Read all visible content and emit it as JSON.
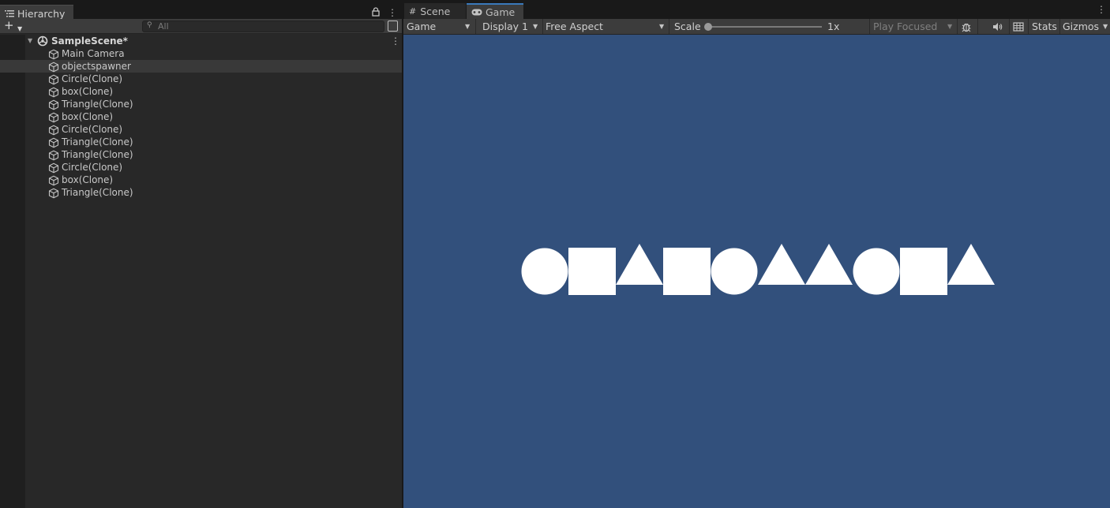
{
  "hierarchy": {
    "tab_label": "Hierarchy",
    "search_placeholder": "All",
    "scene_name": "SampleScene*",
    "items": [
      {
        "label": "Main Camera"
      },
      {
        "label": "objectspawner",
        "selected": true
      },
      {
        "label": "Circle(Clone)"
      },
      {
        "label": "box(Clone)"
      },
      {
        "label": "Triangle(Clone)"
      },
      {
        "label": "box(Clone)"
      },
      {
        "label": "Circle(Clone)"
      },
      {
        "label": "Triangle(Clone)"
      },
      {
        "label": "Triangle(Clone)"
      },
      {
        "label": "Circle(Clone)"
      },
      {
        "label": "box(Clone)"
      },
      {
        "label": "Triangle(Clone)"
      }
    ]
  },
  "game_panel": {
    "tabs": {
      "scene": "Scene",
      "game": "Game"
    },
    "toolbar": {
      "view_mode": "Game",
      "display": "Display 1",
      "aspect": "Free Aspect",
      "scale_label": "Scale",
      "scale_value": "1x",
      "play_mode": "Play Focused",
      "stats": "Stats",
      "gizmos": "Gizmos"
    },
    "background_color": "#32507c",
    "shape_color": "#ffffff",
    "shapes": [
      "circle",
      "box",
      "triangle",
      "box",
      "circle",
      "triangle",
      "triangle",
      "circle",
      "box",
      "triangle"
    ]
  }
}
